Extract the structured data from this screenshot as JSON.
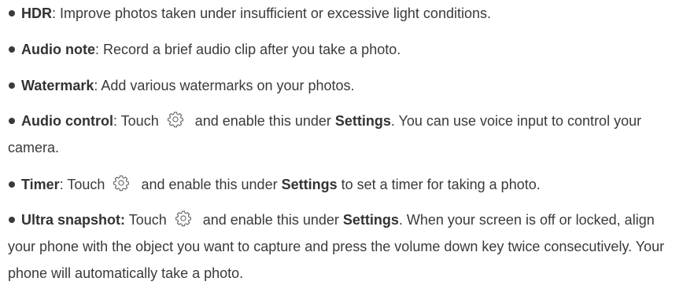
{
  "icons": {
    "settings": "gear-icon"
  },
  "items": [
    {
      "term": "HDR",
      "sep": ":",
      "text": " Improve photos taken under insufficient or excessive light conditions."
    },
    {
      "term": "Audio note",
      "sep": ":",
      "text": " Record a brief audio clip after you take a photo."
    },
    {
      "term": "Watermark",
      "sep": ":",
      "text": " Add various watermarks on your photos."
    },
    {
      "term": "Audio control",
      "sep": ":",
      "pre": " Touch",
      "mid": "and enable this under ",
      "bold": "Settings",
      "post": ". You can use voice input to control your camera."
    },
    {
      "term": "Timer",
      "sep": ":",
      "pre": " Touch",
      "mid": "and enable this under ",
      "bold": "Settings",
      "post": " to set a timer for taking a photo."
    },
    {
      "term": "Ultra snapshot:",
      "sep": "",
      "pre": " Touch",
      "mid": "and enable this under ",
      "bold": "Settings",
      "post": ". When your screen is off or locked, align your phone with the object you want to capture and press the volume down key twice consecutively. Your phone will automatically take a photo."
    }
  ]
}
